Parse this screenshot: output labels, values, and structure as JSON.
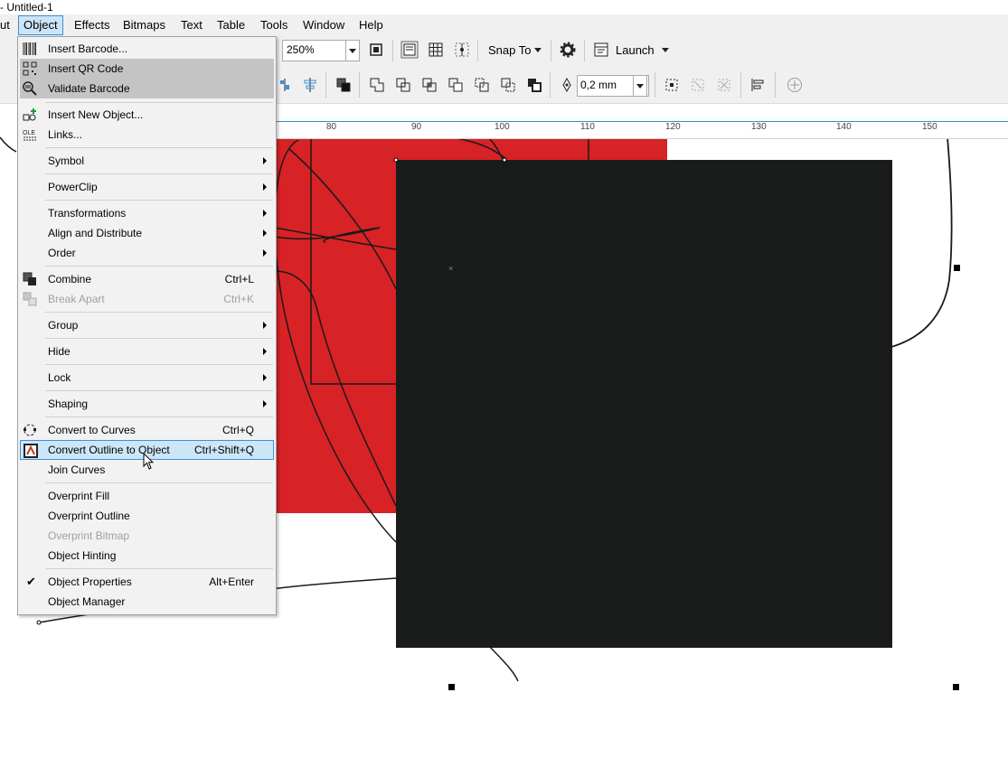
{
  "window": {
    "title": "- Untitled-1"
  },
  "menubar": {
    "items": [
      {
        "key": "layout",
        "label": "ut"
      },
      {
        "key": "object",
        "label": "Object"
      },
      {
        "key": "effects",
        "label": "Effects"
      },
      {
        "key": "bitmaps",
        "label": "Bitmaps"
      },
      {
        "key": "text",
        "label": "Text"
      },
      {
        "key": "table",
        "label": "Table"
      },
      {
        "key": "tools",
        "label": "Tools"
      },
      {
        "key": "window",
        "label": "Window"
      },
      {
        "key": "help",
        "label": "Help"
      }
    ]
  },
  "toolbar": {
    "zoom_value": "250%",
    "snap_to_label": "Snap To",
    "launch_label": "Launch",
    "outline_width": "0,2 mm"
  },
  "ruler": {
    "labels": [
      "80",
      "90",
      "100",
      "110",
      "120",
      "130",
      "140",
      "150"
    ]
  },
  "object_menu": {
    "items": [
      {
        "label": "Insert Barcode...",
        "shortcut": "",
        "icon": "barcode-icon"
      },
      {
        "label": "Insert QR Code",
        "shortcut": "",
        "icon": "qr-code-icon",
        "highlight": "gray"
      },
      {
        "label": "Validate Barcode",
        "shortcut": "",
        "icon": "validate-barcode-icon",
        "highlight": "gray"
      },
      {
        "label": "Insert New Object...",
        "shortcut": "",
        "icon": "insert-object-icon"
      },
      {
        "label": "Links...",
        "shortcut": "",
        "icon": "ole-links-icon"
      },
      {
        "label": "Symbol",
        "submenu": true
      },
      {
        "label": "PowerClip",
        "submenu": true
      },
      {
        "label": "Transformations",
        "submenu": true
      },
      {
        "label": "Align and Distribute",
        "submenu": true
      },
      {
        "label": "Order",
        "submenu": true
      },
      {
        "label": "Combine",
        "shortcut": "Ctrl+L",
        "icon": "combine-icon"
      },
      {
        "label": "Break Apart",
        "shortcut": "Ctrl+K",
        "icon": "break-apart-icon",
        "disabled": true
      },
      {
        "label": "Group",
        "submenu": true
      },
      {
        "label": "Hide",
        "submenu": true
      },
      {
        "label": "Lock",
        "submenu": true
      },
      {
        "label": "Shaping",
        "submenu": true
      },
      {
        "label": "Convert to Curves",
        "shortcut": "Ctrl+Q",
        "icon": "convert-to-curves-icon"
      },
      {
        "label": "Convert Outline to Object",
        "shortcut": "Ctrl+Shift+Q",
        "icon": "convert-outline-icon",
        "highlight": "blue"
      },
      {
        "label": "Join Curves",
        "shortcut": ""
      },
      {
        "label": "Overprint Fill",
        "shortcut": ""
      },
      {
        "label": "Overprint Outline",
        "shortcut": ""
      },
      {
        "label": "Overprint Bitmap",
        "shortcut": "",
        "disabled": true
      },
      {
        "label": "Object Hinting",
        "shortcut": ""
      },
      {
        "label": "Object Properties",
        "shortcut": "Alt+Enter",
        "checked": true
      },
      {
        "label": "Object Manager",
        "shortcut": ""
      }
    ]
  },
  "canvas": {
    "red_fill": "#d72226",
    "black_fill": "#1a1b1b"
  }
}
